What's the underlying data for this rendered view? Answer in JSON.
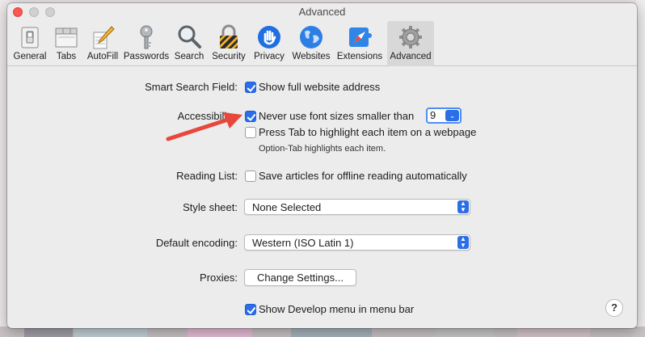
{
  "window": {
    "title": "Advanced"
  },
  "toolbar": {
    "items": [
      {
        "label": "General",
        "icon": "general-switch-icon"
      },
      {
        "label": "Tabs",
        "icon": "tabs-icon"
      },
      {
        "label": "AutoFill",
        "icon": "autofill-pencil-icon"
      },
      {
        "label": "Passwords",
        "icon": "key-icon"
      },
      {
        "label": "Search",
        "icon": "magnifier-icon"
      },
      {
        "label": "Security",
        "icon": "padlock-icon"
      },
      {
        "label": "Privacy",
        "icon": "hand-icon"
      },
      {
        "label": "Websites",
        "icon": "globe-icon"
      },
      {
        "label": "Extensions",
        "icon": "puzzle-compass-icon"
      },
      {
        "label": "Advanced",
        "icon": "gear-icon",
        "selected": true
      }
    ]
  },
  "settings": {
    "smart_search": {
      "label": "Smart Search Field:",
      "option": "Show full website address",
      "checked": true
    },
    "accessibility": {
      "label": "Accessibility:",
      "min_font_option": "Never use font sizes smaller than",
      "min_font_checked": true,
      "min_font_value": "9",
      "tab_option": "Press Tab to highlight each item on a webpage",
      "tab_checked": false,
      "tab_hint": "Option-Tab highlights each item."
    },
    "reading_list": {
      "label": "Reading List:",
      "option": "Save articles for offline reading automatically",
      "checked": false
    },
    "style_sheet": {
      "label": "Style sheet:",
      "value": "None Selected"
    },
    "encoding": {
      "label": "Default encoding:",
      "value": "Western (ISO Latin 1)"
    },
    "proxies": {
      "label": "Proxies:",
      "button": "Change Settings..."
    },
    "develop": {
      "option": "Show Develop menu in menu bar",
      "checked": true
    }
  },
  "help": {
    "label": "?"
  },
  "colors": {
    "accent": "#2a6ee8",
    "arrow": "#e8473b",
    "close": "#fc5753"
  }
}
